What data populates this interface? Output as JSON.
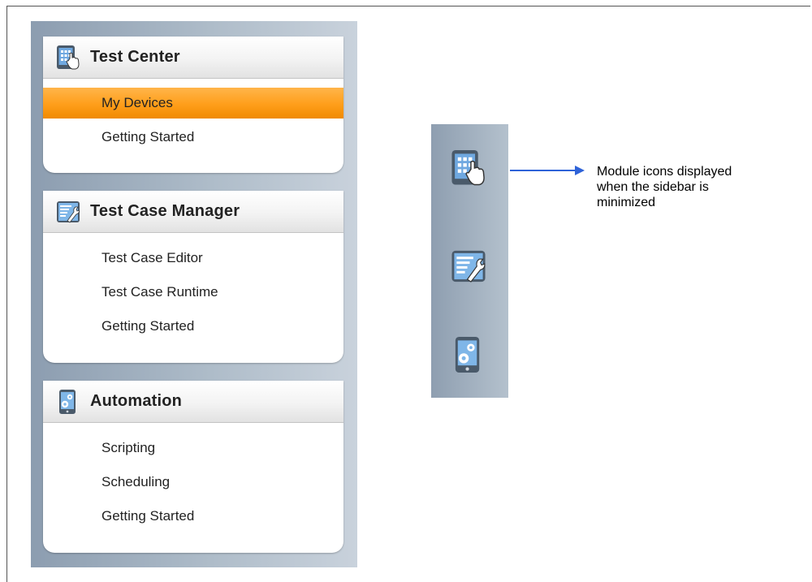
{
  "sidebar": {
    "modules": [
      {
        "title": "Test Center",
        "icon": "tablet-touch-icon",
        "items": [
          {
            "label": "My Devices",
            "active": true
          },
          {
            "label": "Getting Started",
            "active": false
          }
        ]
      },
      {
        "title": "Test Case Manager",
        "icon": "document-tools-icon",
        "items": [
          {
            "label": "Test Case Editor",
            "active": false
          },
          {
            "label": "Test Case Runtime",
            "active": false
          },
          {
            "label": "Getting Started",
            "active": false
          }
        ]
      },
      {
        "title": "Automation",
        "icon": "mobile-gear-icon",
        "items": [
          {
            "label": "Scripting",
            "active": false
          },
          {
            "label": "Scheduling",
            "active": false
          },
          {
            "label": "Getting Started",
            "active": false
          }
        ]
      }
    ]
  },
  "minimized_sidebar": {
    "icons": [
      "tablet-touch-icon",
      "document-tools-icon",
      "mobile-gear-icon"
    ]
  },
  "callout": {
    "text": "Module icons displayed when the sidebar is minimized"
  },
  "colors": {
    "active_item": "#ff9e1a",
    "arrow": "#2f63d8",
    "sidebar_bg": "#9fb0c1"
  }
}
